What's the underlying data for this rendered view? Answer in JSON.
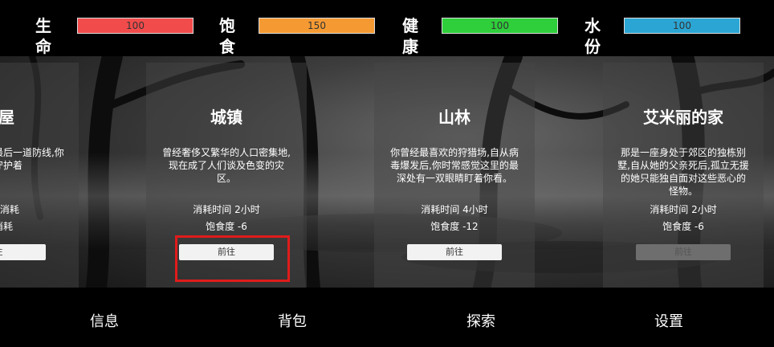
{
  "stats": [
    {
      "label": "生命",
      "value": "100",
      "color": "#f24b4b"
    },
    {
      "label": "饱食",
      "value": "150",
      "color": "#f59a33"
    },
    {
      "label": "健康",
      "value": "100",
      "color": "#2ecf3a"
    },
    {
      "label": "水份",
      "value": "100",
      "color": "#2ba6d4"
    }
  ],
  "cards": [
    {
      "title": "全屋",
      "desc": "芥的世界中,它最后一道防线,你一样守护着",
      "cost": "时 无消耗",
      "food": "无消耗",
      "button": "往",
      "disabled": false
    },
    {
      "title": "城镇",
      "desc": "曾经奢侈又繁华的人口密集地,现在成了人们谈及色变的灾区。",
      "cost": "消耗时间 2小时",
      "food": "饱食度 -6",
      "button": "前往",
      "disabled": false
    },
    {
      "title": "山林",
      "desc": "你曾经最喜欢的狩猎场,自从病毒爆发后,你时常感觉这里的最深处有一双眼睛盯着你看。",
      "cost": "消耗时间 4小时",
      "food": "饱食度 -12",
      "button": "前往",
      "disabled": false
    },
    {
      "title": "艾米丽的家",
      "desc": "那是一座身处于郊区的独栋别墅,自从她的父亲死后,孤立无援的她只能独自面对这些恶心的怪物。",
      "cost": "消耗时间 2小时",
      "food": "饱食度 -6",
      "button": "前往",
      "disabled": true
    }
  ],
  "nav": [
    {
      "label": "信息"
    },
    {
      "label": "背包"
    },
    {
      "label": "探索"
    },
    {
      "label": "设置"
    }
  ]
}
